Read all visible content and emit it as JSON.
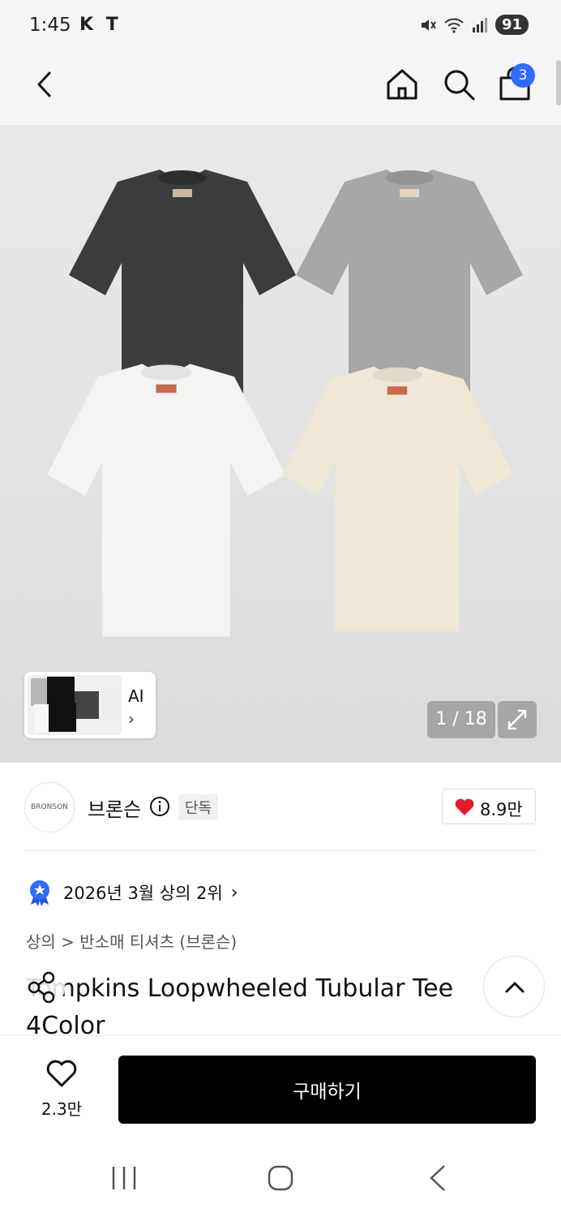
{
  "status_bar": {
    "time": "1:45",
    "carrier": "K T",
    "battery": "91"
  },
  "nav": {
    "cart_count": "3"
  },
  "gallery": {
    "ai_label": "AI",
    "ai_chevron": "›",
    "counter": "1 / 18",
    "shirt_colors": [
      "#3a3d3b",
      "#a7a7a7",
      "#f1f1ef",
      "#efe8d6"
    ]
  },
  "brand": {
    "name": "브론슨",
    "badge": "단독",
    "likes": "8.9만",
    "logo_text": "BRONSON"
  },
  "rank": {
    "text": "2026년 3월 상의 2위",
    "chevron": "›"
  },
  "breadcrumb": "상의 > 반소매 티셔츠 (브론슨)",
  "product": {
    "title": "Tompkins Loopwheeled Tubular Tee 4Color"
  },
  "bottom": {
    "wish_count": "2.3만",
    "buy_label": "구매하기"
  },
  "colors": {
    "accent": "#2f6bff",
    "heart": "#e8182b",
    "buy_bg": "#000000"
  }
}
